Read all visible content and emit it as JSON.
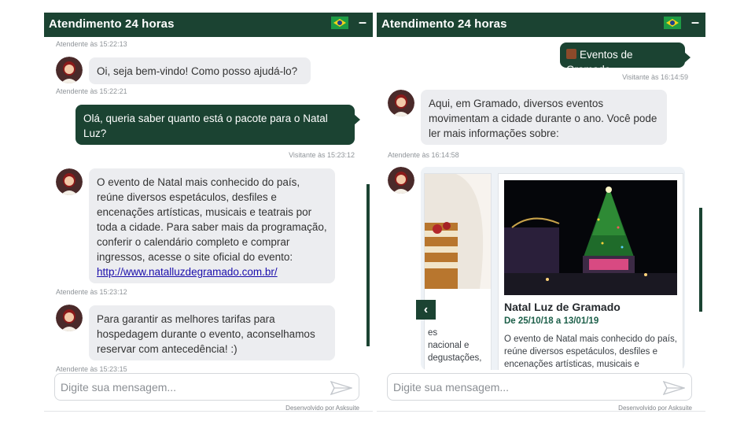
{
  "colors": {
    "brand": "#1b4332",
    "bubble": "#ecedf0",
    "link": "#1a0dab"
  },
  "left": {
    "header_title": "Atendimento 24 horas",
    "minimize": "–",
    "messages": {
      "ts1": "Atendente às 15:22:13",
      "m1": "Oi, seja bem-vindo! Como posso ajudá-lo?",
      "ts2": "Atendente às 15:22:21",
      "v1": "Olá, queria saber quanto está o pacote para o Natal Luz?",
      "ts3": "Visitante às 15:23:12",
      "m2_text": "O evento de Natal mais conhecido do país, reúne diversos espetáculos, desfiles e encenações artísticas, musicais e teatrais por toda a cidade. Para saber mais da programação, conferir o calendário completo e comprar ingressos, acesse o site oficial do evento:",
      "m2_link": "http://www.natalluzdegramado.com.br/",
      "ts4": "Atendente às 15:23:12",
      "m3": "Para garantir as melhores tarifas para hospedagem durante o evento, aconselhamos reservar com antecedência! :)",
      "ts5": "Atendente às 15:23:15"
    },
    "input_placeholder": "Digite sua mensagem...",
    "powered": "Desenvolvido por Asksuite"
  },
  "right": {
    "header_title": "Atendimento 24 horas",
    "minimize": "–",
    "visitor_msg": "Eventos de Gramado",
    "ts1": "Visitante às 16:14:59",
    "m1": "Aqui, em Gramado, diversos eventos movimentam a cidade durante o ano. Você pode ler mais informações sobre:",
    "ts2": "Atendente às 16:14:58",
    "card_prev": {
      "desc_frag": "es\nnacional e\ndegustações,"
    },
    "card": {
      "title": "Natal Luz de Gramado",
      "date": "De 25/10/18 a 13/01/19",
      "desc": "O evento de Natal mais conhecido do país, reúne diversos espetáculos, desfiles e encenações artísticas, musicais e"
    },
    "prev_arrow": "‹",
    "input_placeholder": "Digite sua mensagem...",
    "powered": "Desenvolvido por Asksuite"
  }
}
